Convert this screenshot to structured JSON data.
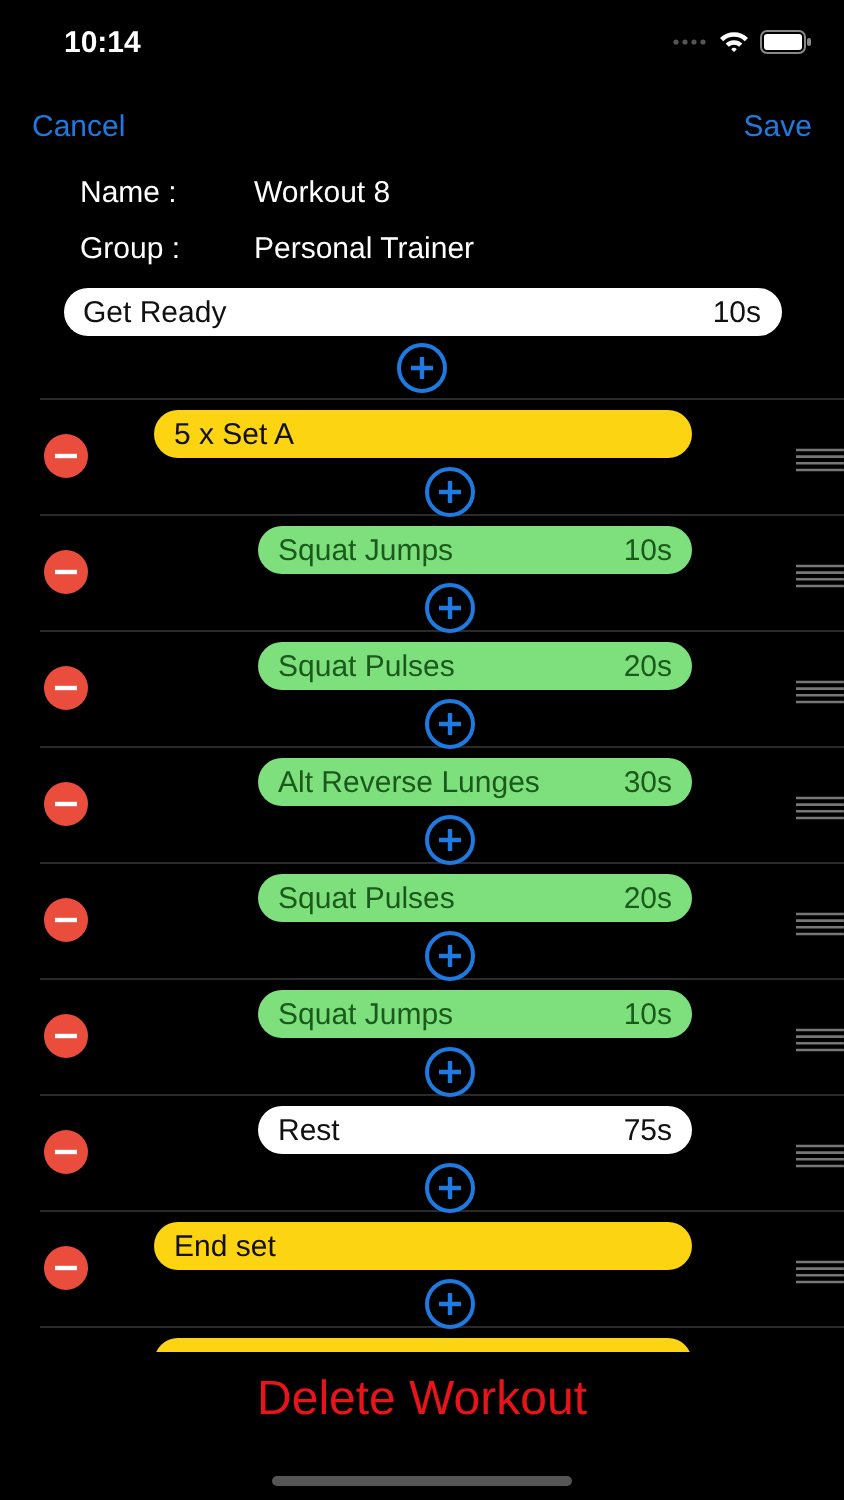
{
  "status_bar": {
    "time": "10:14"
  },
  "nav": {
    "cancel": "Cancel",
    "save": "Save"
  },
  "details": [
    {
      "label": "Name :",
      "value": "Workout 8"
    },
    {
      "label": "Group :",
      "value": "Personal Trainer"
    }
  ],
  "start_item": {
    "name": "Get Ready",
    "duration": "10s"
  },
  "items": [
    {
      "kind": "set",
      "name": "5 x Set A"
    },
    {
      "kind": "exercise",
      "name": "Squat Jumps",
      "duration": "10s"
    },
    {
      "kind": "exercise",
      "name": "Squat Pulses",
      "duration": "20s"
    },
    {
      "kind": "exercise",
      "name": "Alt Reverse Lunges",
      "duration": "30s"
    },
    {
      "kind": "exercise",
      "name": "Squat Pulses",
      "duration": "20s"
    },
    {
      "kind": "exercise",
      "name": "Squat Jumps",
      "duration": "10s"
    },
    {
      "kind": "rest",
      "name": "Rest",
      "duration": "75s"
    },
    {
      "kind": "set",
      "name": "End set"
    }
  ],
  "cut_off_item": {
    "kind": "set"
  },
  "delete_button": "Delete Workout"
}
